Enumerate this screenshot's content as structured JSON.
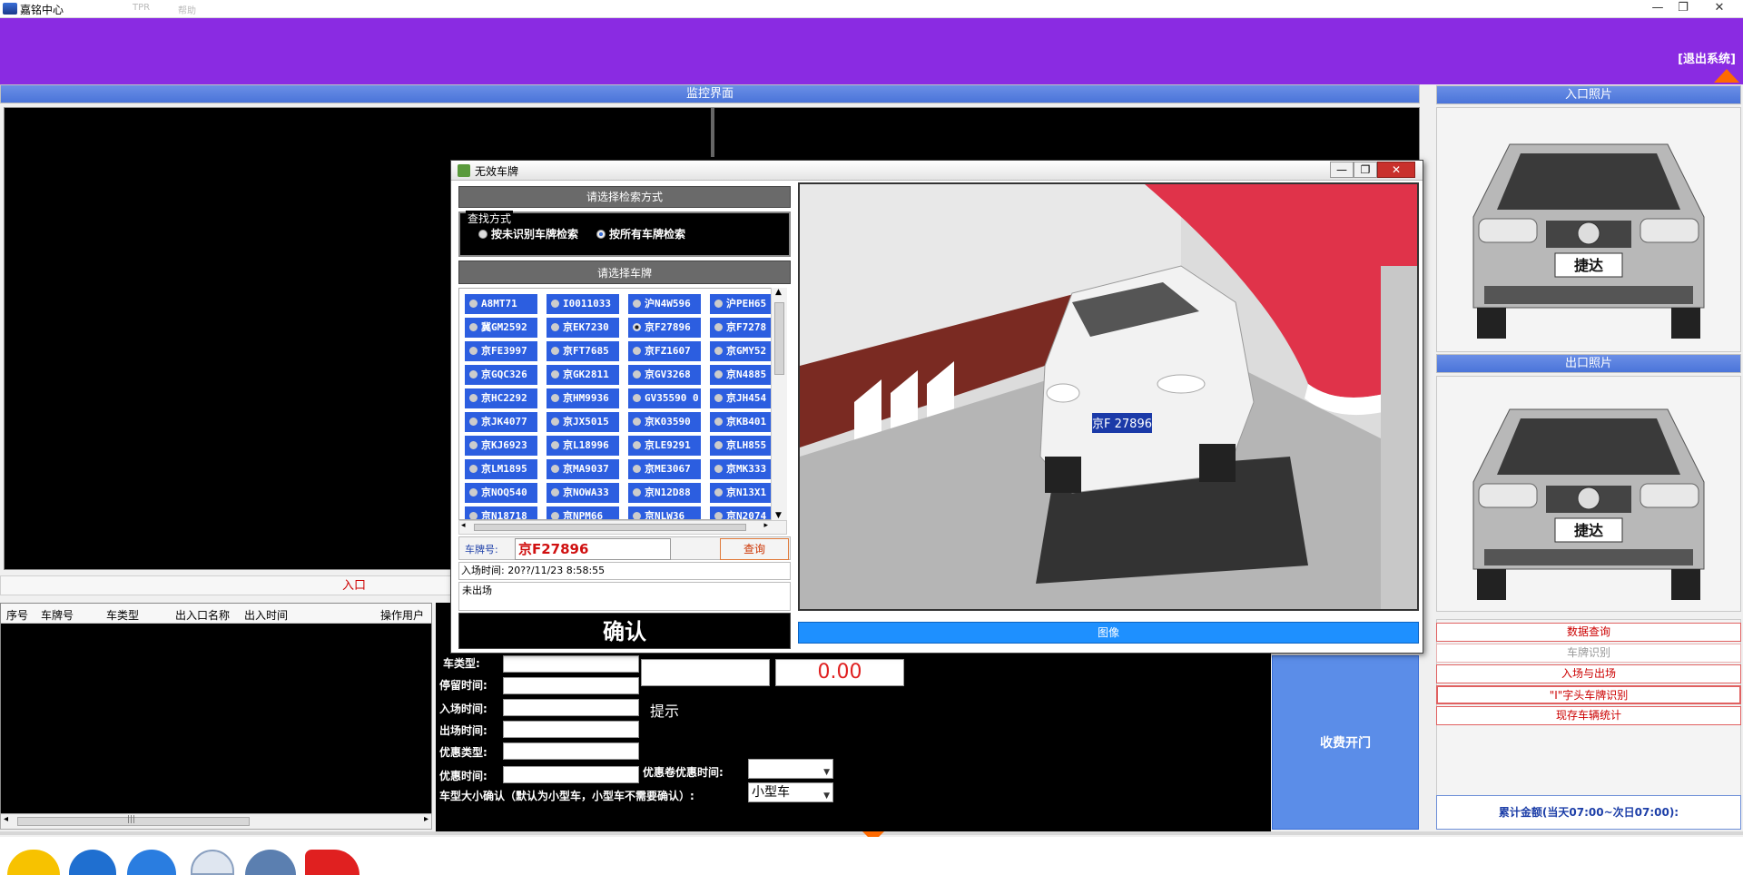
{
  "titlebar": {
    "title": "嘉铭中心",
    "faded_items": [
      "TPR",
      "帮助"
    ],
    "minimize": "—",
    "restore": "❐",
    "close": "✕"
  },
  "header": {
    "exit_label": "[退出系统]"
  },
  "monitor": {
    "title": "监控界面",
    "entrance_label": "入口"
  },
  "photos": {
    "entry_title": "入口照片",
    "exit_title": "出口照片",
    "car_badge": "捷达"
  },
  "record_table": {
    "headers": [
      "序号",
      "车牌号",
      "车类型",
      "出入口名称",
      "出入时间",
      "操作用户"
    ],
    "scroll_grip": "|||"
  },
  "charge": {
    "car_type_label": "车类型:",
    "stay_time_label": "停留时间:",
    "entry_time_label": "入场时间:",
    "exit_time_label": "出场时间:",
    "discount_type_label": "优惠类型:",
    "discount_time_label": "优惠时间:",
    "hint_label": "提示",
    "amount": "0.00",
    "coupon_time_label": "优惠卷优惠时间:",
    "coupon_time_value": "",
    "size_confirm_label": "车型大小确认（默认为小型车，小型车不需要确认）:",
    "size_value": "小型车",
    "open_gate": "收费开门"
  },
  "right_menu": {
    "items": [
      "数据查询",
      "车牌识别",
      "入场与出场",
      "\"I\"字头车牌识别",
      "现存车辆统计"
    ],
    "total": "累计金额(当天07:00~次日07:00):"
  },
  "dialog": {
    "title": "无效车牌",
    "search_mode_bar": "请选择检索方式",
    "search_legend": "查找方式",
    "radio_unrecognized": "按未识别车牌检索",
    "radio_all": "按所有车牌检索",
    "select_plate_bar": "请选择车牌",
    "plates": [
      [
        "A8MT71",
        "冀GM2592",
        "京FE3997",
        "京GQC326",
        "京HC2292",
        "京JK4077",
        "京KJ6923",
        "京LM1895",
        "京NOQ540",
        "京N18718"
      ],
      [
        "I0011033",
        "京EK7230",
        "京FT7685",
        "京GK2811",
        "京HM9936",
        "京JX5015",
        "京L18996",
        "京MA9037",
        "京NOWA33",
        "京NPM66"
      ],
      [
        "沪N4W596",
        "京F27896",
        "京FZ1607",
        "京GV3268",
        "GV35590 0",
        "京K03590",
        "京LE9291",
        "京ME3067",
        "京N12D88",
        "京NLW36"
      ],
      [
        "沪PEH65",
        "京F7278",
        "京GMY52",
        "京N4885",
        "京JH454",
        "京KB401",
        "京LH855",
        "京MK333",
        "京N13X1",
        "京N2074"
      ]
    ],
    "plate_label": "车牌号:",
    "plate_value": "京F27896",
    "query_button": "查询",
    "entry_time": "入场时间: 20??/11/23 8:58:55",
    "status": "未出场",
    "confirm_button": "确认",
    "image_button": "图像",
    "scene_plate": "京F 27896"
  },
  "colors": {
    "header_purple": "#8a2be2",
    "accent_blue": "#4a74d9",
    "plate_blue": "#2c5ee0",
    "alert_red": "#cc0000",
    "orange": "#ff6a00"
  }
}
